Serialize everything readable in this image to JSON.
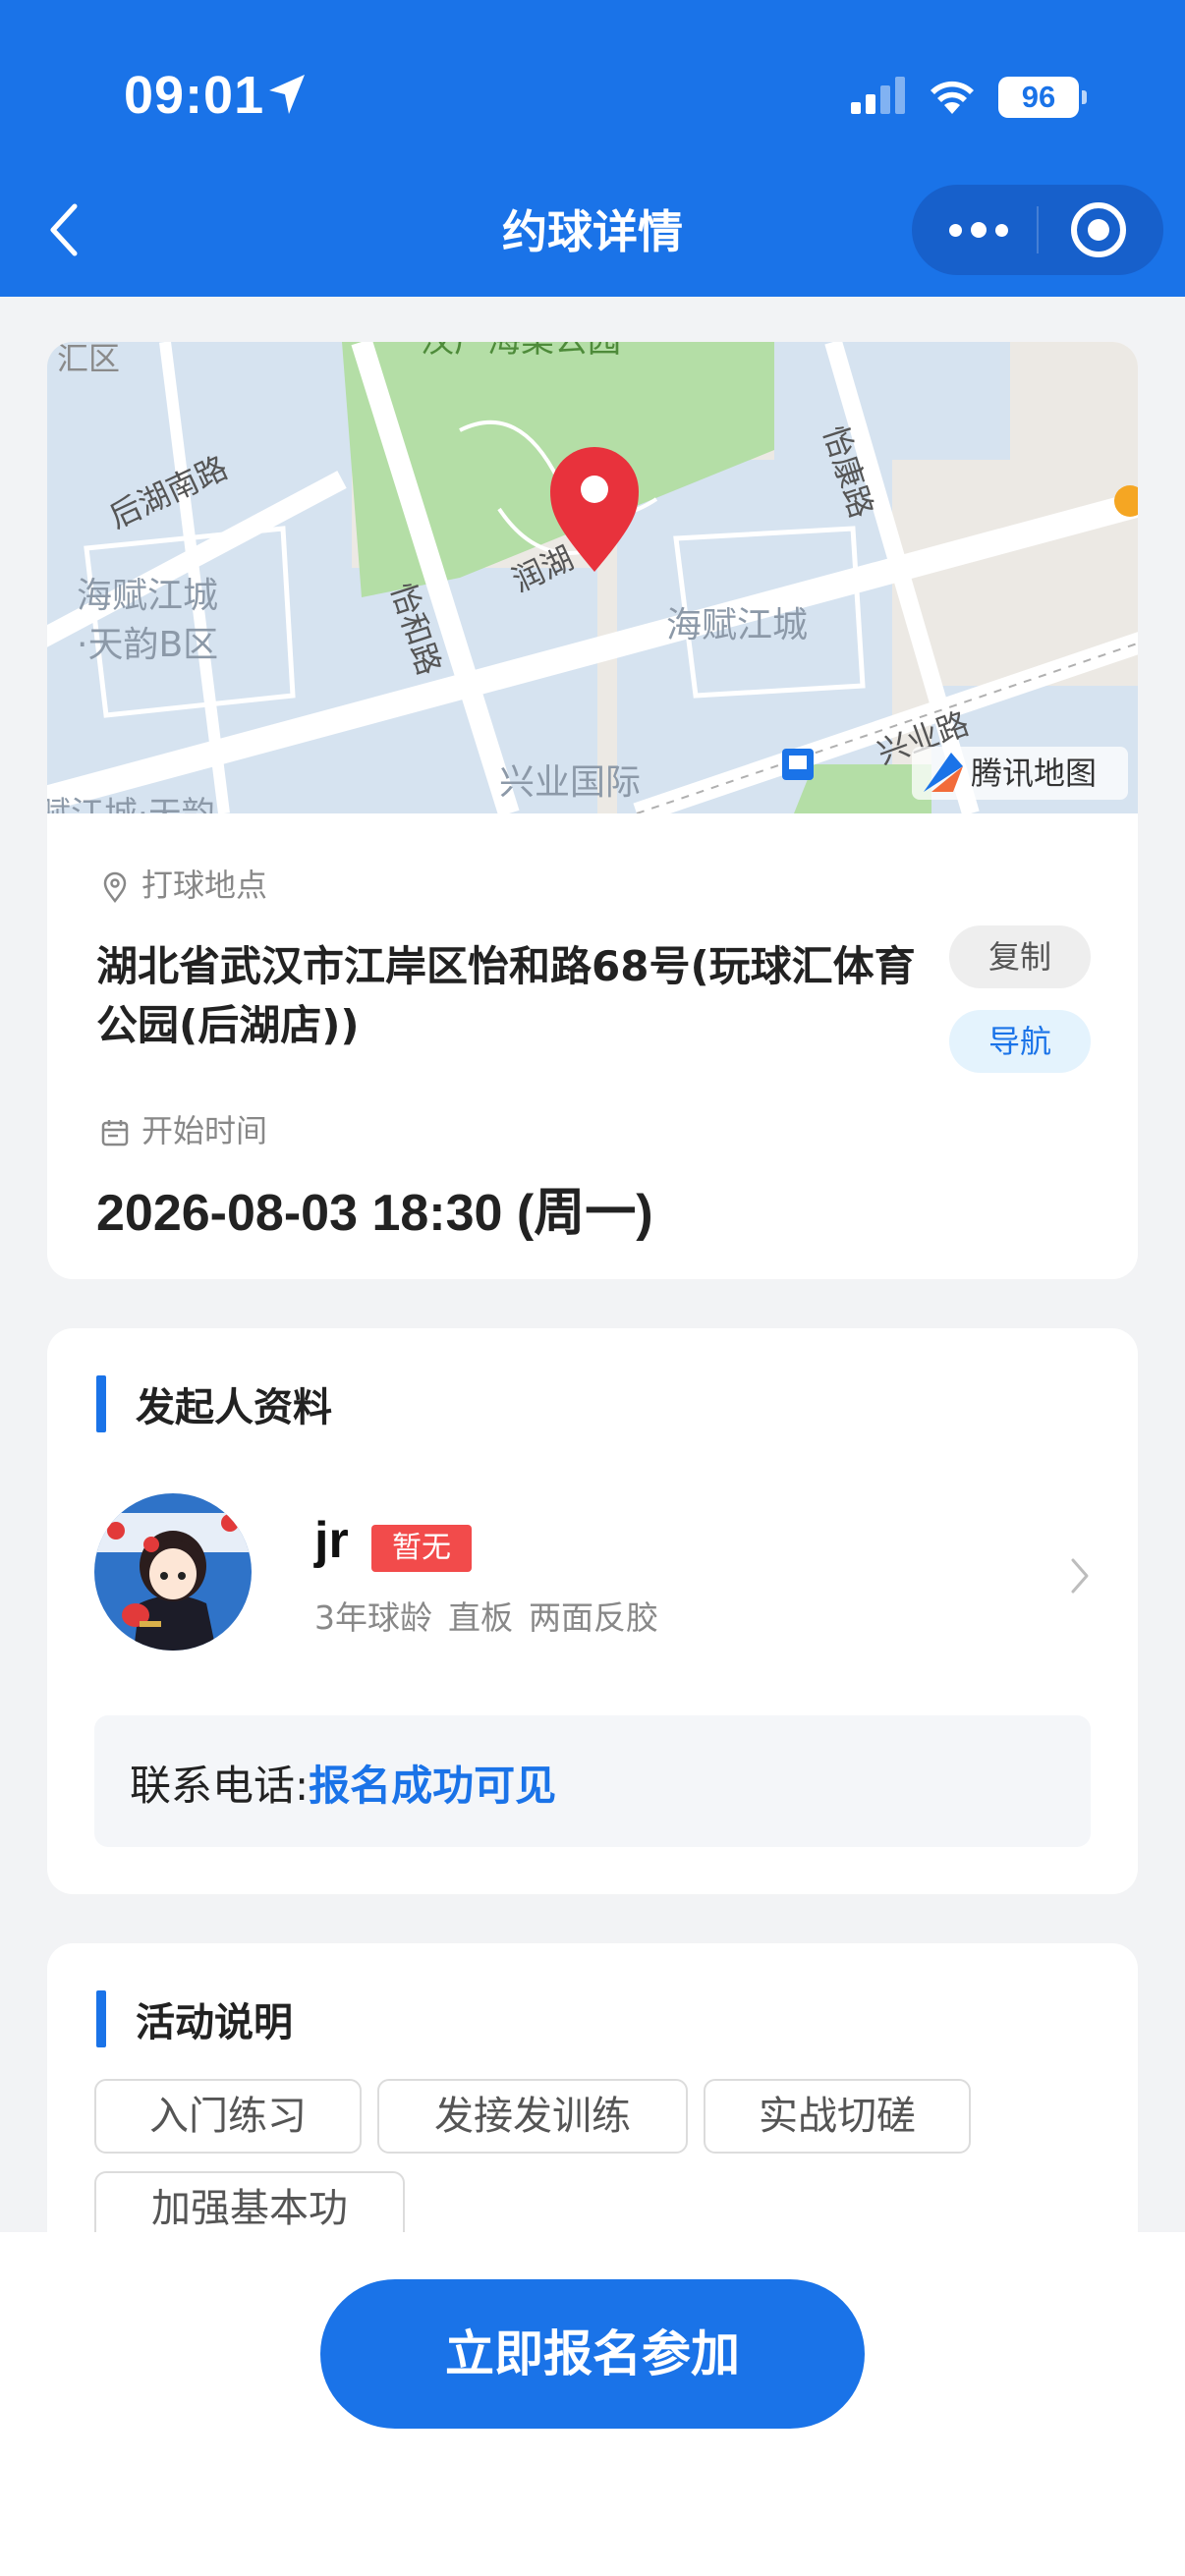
{
  "status_bar": {
    "time": "09:01",
    "battery": "96"
  },
  "nav": {
    "title": "约球详情"
  },
  "map": {
    "labels": {
      "park": "汉厂海棠公园",
      "district_top_left": "汇区",
      "houhu_south_road": "后湖南路",
      "yihe_road": "怡和路",
      "runhu": "润湖",
      "yikang_road": "怡康路",
      "haifu_tianyun": "海赋江城",
      "haifu_tianyun_b": "·天韵B区",
      "haifu_right": "海赋江城",
      "xingye_intl": "兴业国际",
      "xingye_road": "兴业路",
      "bottom_left": "赋江城·天韵",
      "brand": "腾讯地图"
    }
  },
  "location": {
    "place_label": "打球地点",
    "address": "湖北省武汉市江岸区怡和路68号(玩球汇体育公园(后湖店))",
    "copy_label": "复制",
    "navigate_label": "导航",
    "time_label": "开始时间",
    "datetime": "2026-08-03 18:30 (周一)"
  },
  "host": {
    "section_title": "发起人资料",
    "name": "jr",
    "level_badge": "暂无",
    "meta": [
      "3年球龄",
      "直板",
      "两面反胶"
    ],
    "contact_prefix": "联系电话:",
    "contact_value": "报名成功可见"
  },
  "activity": {
    "section_title": "活动说明",
    "tags": [
      "入门练习",
      "发接发训练",
      "实战切磋",
      "加强基本功"
    ]
  },
  "footer": {
    "signup_label": "立即报名参加"
  },
  "colors": {
    "primary": "#1a73e8",
    "badge_red": "#f24b4b",
    "map_pin": "#e8323c",
    "page_bg": "#f2f3f5"
  }
}
